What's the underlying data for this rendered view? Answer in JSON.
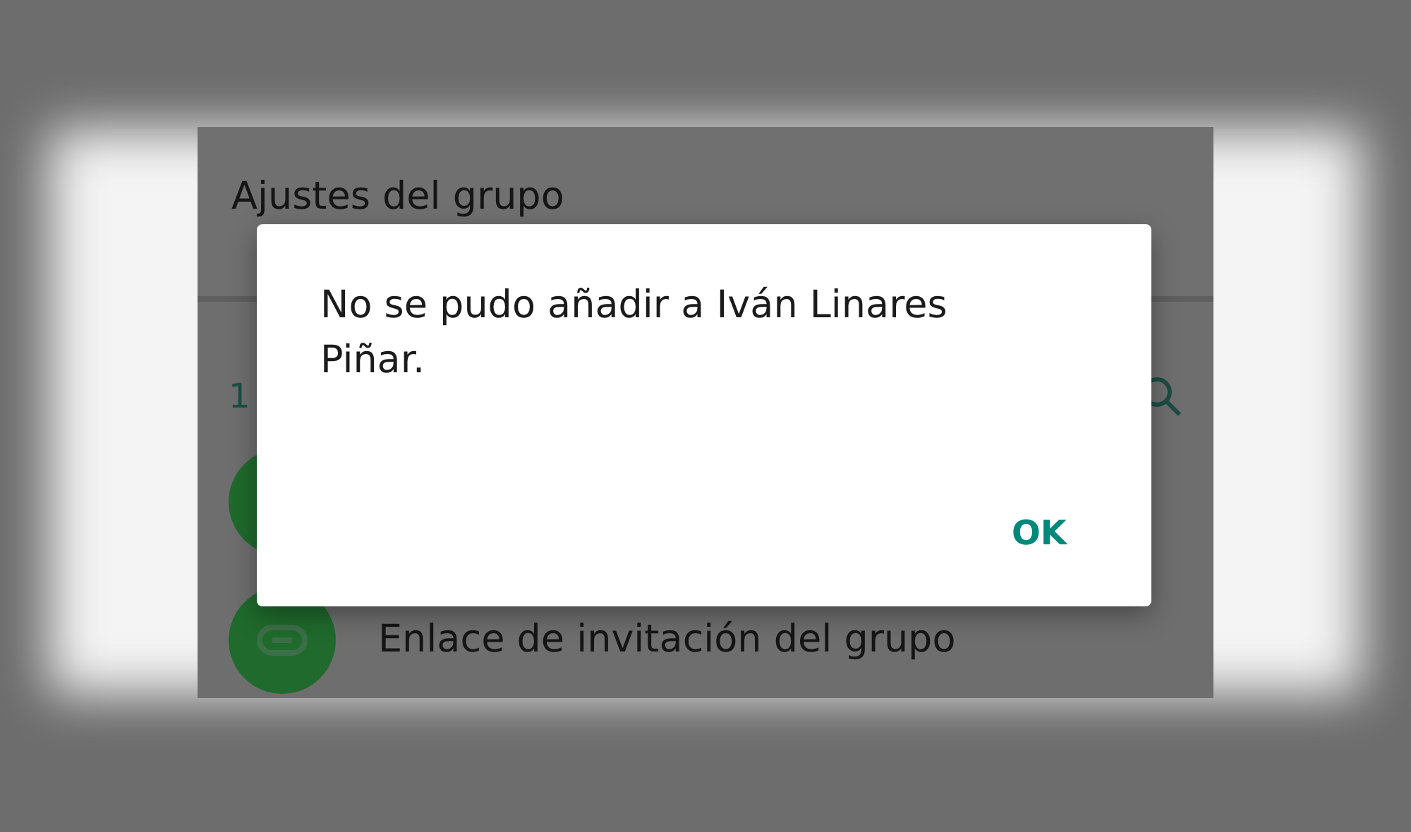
{
  "screen": {
    "title": "Ajustes del grupo",
    "participants_count": "1",
    "rows": [
      {
        "kind": "add"
      },
      {
        "kind": "link",
        "label": "Enlace de invitación del grupo"
      }
    ]
  },
  "dialog": {
    "message": "No se pudo añadir a Iván Linares Piñar.",
    "buttons": [
      "OK"
    ]
  }
}
